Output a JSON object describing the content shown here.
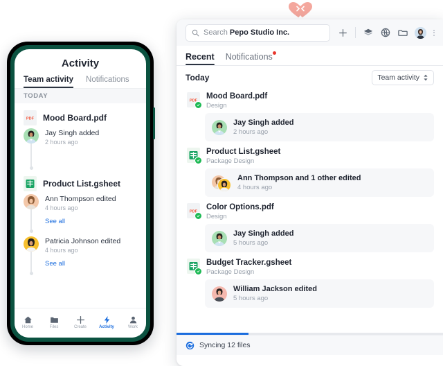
{
  "cursor_badge": {
    "icon": "heart-emoji",
    "color": "#f4a79d"
  },
  "desktop": {
    "search": {
      "prefix": "Search ",
      "workspace": "Pepo Studio Inc.",
      "icon": "search-icon"
    },
    "toolbar_icons": [
      {
        "name": "plus-icon",
        "label": "+"
      },
      {
        "name": "layers-icon",
        "label": "Layers"
      },
      {
        "name": "globe-icon",
        "label": "Globe"
      },
      {
        "name": "folder-icon",
        "label": "Folder"
      }
    ],
    "account": {
      "name": "avatar",
      "menu": "kebab-menu-icon"
    },
    "tabs": [
      {
        "label": "Recent",
        "active": true,
        "badge": false
      },
      {
        "label": "Notifications",
        "active": false,
        "badge": true
      }
    ],
    "section_title": "Today",
    "filter": {
      "label": "Team activity",
      "icon": "chevron-updown-icon"
    },
    "files": [
      {
        "name": "Mood Board.pdf",
        "folder": "Design",
        "type": "pdf",
        "type_label": "PDF",
        "synced": true,
        "activity": {
          "text": "Jay Singh added",
          "time": "2 hours ago",
          "avatar": "jay-singh",
          "avatar_count": 1
        }
      },
      {
        "name": "Product List.gsheet",
        "folder": "Package Design",
        "type": "gsheet",
        "type_label": "",
        "synced": true,
        "activity": {
          "text": "Ann Thompson and 1 other edited",
          "time": "4 hours ago",
          "avatar": "ann-thompson",
          "avatar_count": 2
        }
      },
      {
        "name": "Color Options.pdf",
        "folder": "Design",
        "type": "pdf",
        "type_label": "PDF",
        "synced": true,
        "activity": {
          "text": "Jay Singh added",
          "time": "5 hours ago",
          "avatar": "jay-singh",
          "avatar_count": 1
        }
      },
      {
        "name": "Budget Tracker.gsheet",
        "folder": "Package Design",
        "type": "gsheet",
        "type_label": "",
        "synced": true,
        "activity": {
          "text": "William Jackson edited",
          "time": "5 hours ago",
          "avatar": "william-jackson",
          "avatar_count": 1
        }
      }
    ],
    "sync": {
      "label": "Syncing 12 files",
      "icon": "sync-icon",
      "progress_percent": 27,
      "accent": "#1b6dde"
    }
  },
  "phone": {
    "title": "Activity",
    "tabs": [
      {
        "label": "Team activity",
        "active": true
      },
      {
        "label": "Notifications",
        "active": false
      }
    ],
    "section_title": "TODAY",
    "groups": [
      {
        "name": "Mood Board.pdf",
        "type": "pdf",
        "type_label": "PDF",
        "events": [
          {
            "text": "Jay Singh added",
            "time": "2 hours ago",
            "avatar": "jay-singh",
            "see_all": null
          }
        ]
      },
      {
        "name": "Product List.gsheet",
        "type": "gsheet",
        "type_label": "",
        "events": [
          {
            "text": "Ann Thompson edited",
            "time": "4 hours ago",
            "avatar": "ann-thompson",
            "see_all": "See all"
          },
          {
            "text": "Patricia Johnson edited",
            "time": "4 hours ago",
            "avatar": "patricia-johnson",
            "see_all": "See all"
          }
        ]
      }
    ],
    "nav": [
      {
        "label": "Home",
        "icon": "home-icon",
        "active": false
      },
      {
        "label": "Files",
        "icon": "folder-icon",
        "active": false
      },
      {
        "label": "Create",
        "icon": "plus-icon",
        "active": false
      },
      {
        "label": "Activity",
        "icon": "bolt-icon",
        "active": true
      },
      {
        "label": "Work",
        "icon": "person-icon",
        "active": false
      }
    ],
    "frame_color": "#0b5240",
    "accent": "#1b6dde"
  }
}
